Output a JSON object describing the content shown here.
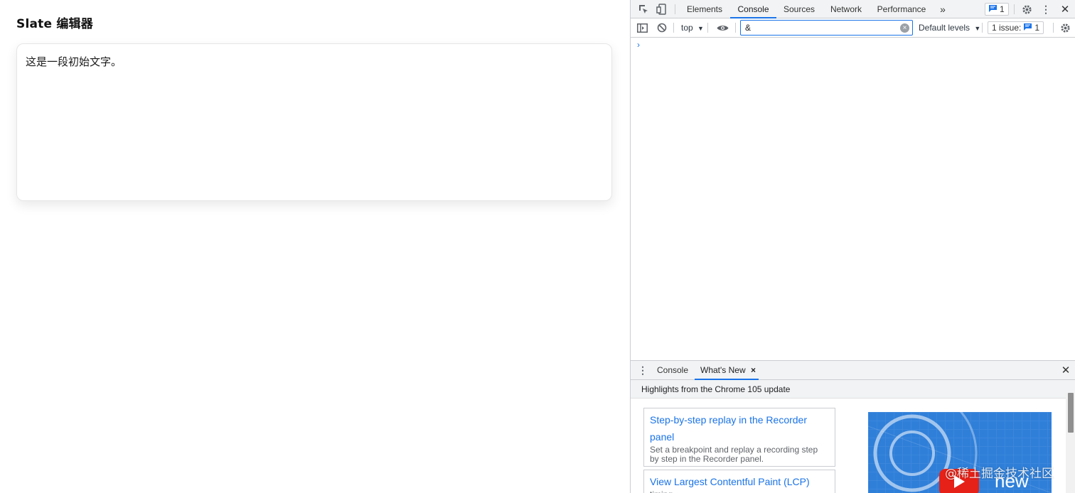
{
  "page": {
    "title": "Slate 编辑器",
    "editor_text": "这是一段初始文字。"
  },
  "devtools": {
    "tabs": [
      "Elements",
      "Console",
      "Sources",
      "Network",
      "Performance"
    ],
    "active_tab": "Console",
    "more_tabs": "»",
    "issues_badge_count": "1",
    "toolbar": {
      "context": "top",
      "filter_value": "&",
      "log_levels": "Default levels",
      "issues_label": "1 issue:",
      "issues_count": "1"
    },
    "console_prompt": "›",
    "drawer": {
      "tabs": [
        "Console",
        "What's New"
      ],
      "active_tab": "What's New",
      "close_tab": "×",
      "subhead": "Highlights from the Chrome 105 update",
      "cards": [
        {
          "title": "Step-by-step replay in the Recorder panel",
          "desc": "Set a breakpoint and replay a recording step by step in the Recorder panel."
        },
        {
          "title": "View Largest Contentful Paint (LCP)",
          "desc": "timing"
        }
      ],
      "video_label": "new"
    }
  },
  "watermark": "@稀土掘金技术社区",
  "colors": {
    "accent": "#1a73e8",
    "toolbar_bg": "#f1f3f4",
    "border": "#cbcdd1"
  }
}
